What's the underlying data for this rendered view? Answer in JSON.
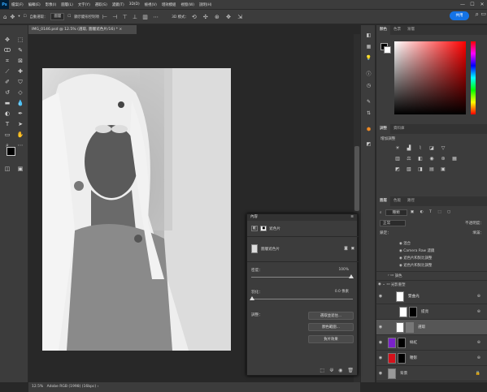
{
  "app": {
    "logo": "Ps"
  },
  "menu": [
    "檔案(F)",
    "編輯(E)",
    "影像(I)",
    "圖層(L)",
    "文字(Y)",
    "選取(S)",
    "濾鏡(T)",
    "3D(D)",
    "檢視(V)",
    "增效模組",
    "視窗(W)",
    "說明(H)"
  ],
  "window_controls": {
    "min": "—",
    "max": "☐",
    "close": "✕"
  },
  "options": {
    "auto_select_label": "自動選取：",
    "auto_select_value": "圖層",
    "transform_label": "顯示變形控制項",
    "mode_3d": "3D 模式：",
    "share_label": "共用"
  },
  "document": {
    "tab_title": "IMG_0146.psd @ 12.5% (選取, 圖層遮色片/16) *",
    "close": "×"
  },
  "status": {
    "zoom": "12.5%",
    "profile": "Adobe RGB (1998) (16bpc)"
  },
  "color_panel": {
    "tabs": [
      "顏色",
      "色票",
      "漸層"
    ],
    "hue_colors": [
      "#ff0000",
      "#ff00ff",
      "#0000ff",
      "#00ffff",
      "#00ff00",
      "#ffff00",
      "#ff0000"
    ]
  },
  "adjust_panel": {
    "tabs": [
      "調整",
      "資料庫"
    ],
    "heading": "增加調整"
  },
  "layers_panel": {
    "tabs": [
      "圖層",
      "色版",
      "路徑"
    ],
    "kind_label": "種類",
    "blend_mode": "正常",
    "opacity_label": "不透明度：",
    "lock_label": "鎖定：",
    "fill_label": "填滿：",
    "sublayers": [
      "混合",
      "Camera Raw 濾鏡",
      "遮色片和對比調整",
      "遮色片和對比調整"
    ],
    "groups": [
      "調色",
      "光影重塑"
    ],
    "layers": [
      {
        "name": "雙曲光",
        "thumb": "#ffffff",
        "mask": "#ffffff",
        "fx": "⊕"
      },
      {
        "name": "提亮",
        "thumb": "#ffffff",
        "mask": "#000000",
        "fx": "⊕"
      },
      {
        "name": "選取",
        "thumb": "#ffffff",
        "mask": "#777777",
        "fx": ""
      },
      {
        "name": "絲紅",
        "thumb": "#7a22c9",
        "mask": "#000000",
        "fx": "⊕"
      },
      {
        "name": "鞭影",
        "thumb": "#d4111b",
        "mask": "#000000",
        "fx": "⊕"
      },
      {
        "name": "背景",
        "thumb": "#999999",
        "mask": "",
        "fx": "🔒"
      }
    ]
  },
  "properties": {
    "title": "內容",
    "type_label": "遮色片",
    "mask_label": "圖層遮色片",
    "density_label": "密度：",
    "density_value": "100%",
    "feather_label": "羽化：",
    "feather_value": "0.0 像素",
    "refine_label": "調整：",
    "btn_select_mask": "選取並遮住...",
    "btn_color_range": "顏色範圍...",
    "btn_invert": "負片效果"
  }
}
